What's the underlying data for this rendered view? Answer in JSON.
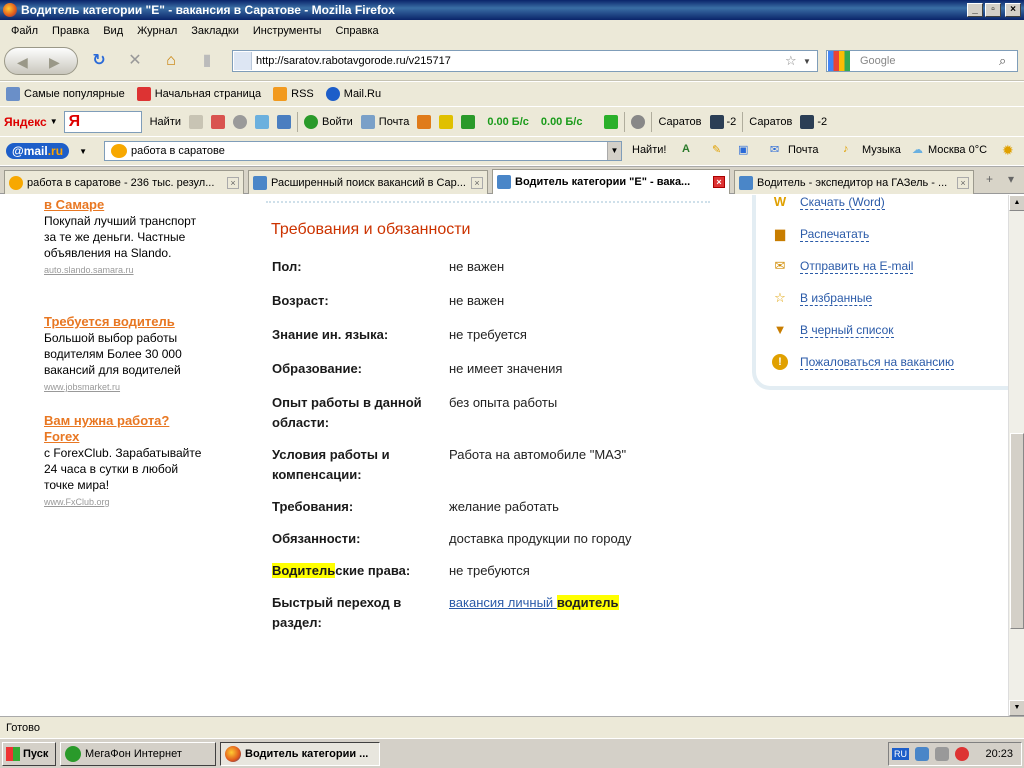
{
  "window": {
    "title": "Водитель категории \"Е\" - вакансия в Саратове - Mozilla Firefox"
  },
  "menu": [
    "Файл",
    "Правка",
    "Вид",
    "Журнал",
    "Закладки",
    "Инструменты",
    "Справка"
  ],
  "nav": {
    "url": "http://saratov.rabotavgorode.ru/v215717",
    "search_placeholder": "Google"
  },
  "bookmarks": [
    "Самые популярные",
    "Начальная страница",
    "RSS",
    "Mail.Ru"
  ],
  "yandex_bar": {
    "logo": "Яндекс",
    "input_glyph": "Я",
    "find": "Найти",
    "enter": "Войти",
    "mail": "Почта",
    "speed_down": "0.00 Б/с",
    "speed_up": "0.00 Б/с",
    "city1": "Саратов",
    "temp1": "-2",
    "city2": "Саратов",
    "temp2": "-2"
  },
  "mail_bar": {
    "logo_main": "@mail",
    "logo_suffix": ".ru",
    "query": "работа в саратове",
    "find": "Найти!",
    "mail": "Почта",
    "music": "Музыка",
    "weather": "Москва 0°C"
  },
  "tabs": [
    {
      "label": "работа в саратове - 236 тыс. резул...",
      "active": false
    },
    {
      "label": "Расширенный поиск вакансий в Сар...",
      "active": false
    },
    {
      "label": "Водитель категории \"Е\" - вака...",
      "active": true
    },
    {
      "label": "Водитель - экспедитор на ГАЗель - ...",
      "active": false
    }
  ],
  "ads": [
    {
      "title": "в Самаре",
      "body": "Покупай лучший транспорт за те же деньги. Частные объявления на Slando.",
      "source": "auto.slando.samara.ru"
    },
    {
      "title": "Требуется водитель",
      "body": "Большой выбор работы водителям Более 30 000 вакансий для водителей",
      "source": "www.jobsmarket.ru"
    },
    {
      "title": "Вам нужна работа? Forex",
      "body": "с ForexClub. Зарабатывайте 24 часа в сутки в любой точке мира!",
      "source": "www.FxClub.org"
    }
  ],
  "requirements": {
    "title": "Требования и обязанности",
    "rows": [
      {
        "key": "Пол:",
        "value": "не важен"
      },
      {
        "key": "Возраст:",
        "value": "не важен"
      },
      {
        "key": "Знание ин. языка:",
        "value": "не требуется"
      },
      {
        "key": "Образование:",
        "value": "не имеет значения"
      },
      {
        "key": "Опыт работы в данной области:",
        "value": "без опыта работы"
      },
      {
        "key": "Условия работы и компенсации:",
        "value": "Работа на автомобиле \"МАЗ\""
      },
      {
        "key": "Требования:",
        "value": "желание работать"
      },
      {
        "key": "Обязанности:",
        "value": "доставка продукции по городу"
      }
    ],
    "license_key_hl": "Водитель",
    "license_key_rest": "ские права:",
    "license_value": "не требуются",
    "quick_key": "Быстрый переход в раздел:",
    "quick_link": "вакансия личный ",
    "quick_link_hl": "водитель"
  },
  "actions": [
    "Скачать (Word)",
    "Распечатать",
    "Отправить на E-mail",
    "В избранные",
    "В черный список",
    "Пожаловаться на вакансию"
  ],
  "status": "Готово",
  "taskbar": {
    "start": "Пуск",
    "apps": [
      {
        "label": "МегаФон Интернет",
        "active": false
      },
      {
        "label": "Водитель категории ...",
        "active": true
      }
    ],
    "lang": "RU",
    "clock": "20:23"
  },
  "colors": {
    "accent_orange": "#e87722",
    "title_red": "#cc3300",
    "link_blue": "#2a5aa8",
    "highlight": "#ffff00"
  }
}
